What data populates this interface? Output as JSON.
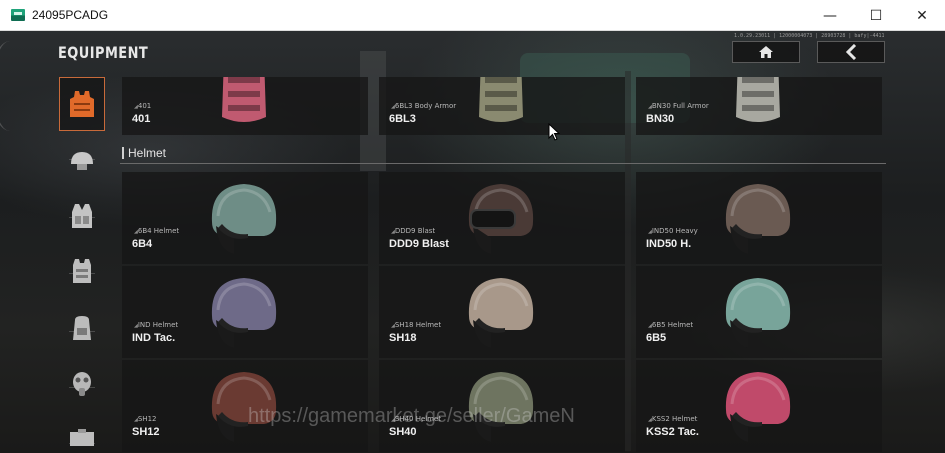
{
  "window": {
    "title": "24095PCADG",
    "minimize": "—",
    "maximize": "☐",
    "close": "✕"
  },
  "game": {
    "title": "EQUIPMENT",
    "info_text": "1.0.29.23011 | 12000004073 | 28903728 | bafy|-44110.118u",
    "watermark": "https://gamemarket.ge/seller/GameN"
  },
  "rail": [
    {
      "name": "vest",
      "icon": "vest-icon",
      "active": true
    },
    {
      "name": "helmet",
      "icon": "helmet-icon",
      "active": false
    },
    {
      "name": "rig",
      "icon": "rig-icon",
      "active": false
    },
    {
      "name": "plate-carrier",
      "icon": "plate-carrier-icon",
      "active": false
    },
    {
      "name": "backpack",
      "icon": "backpack-icon",
      "active": false
    },
    {
      "name": "gas-mask",
      "icon": "gas-mask-icon",
      "active": false
    },
    {
      "name": "case",
      "icon": "case-icon",
      "active": false
    }
  ],
  "armor_row": [
    {
      "sub": "401",
      "name": "401",
      "color": "#c05a70"
    },
    {
      "sub": "6BL3 Body Armor",
      "name": "6BL3",
      "color": "#8a8a70"
    },
    {
      "sub": "BN30 Full Armor",
      "name": "BN30",
      "color": "#a8a8a0"
    }
  ],
  "section": {
    "label": "Helmet"
  },
  "helmets": [
    {
      "sub": "6B4 Helmet",
      "name": "6B4",
      "color": "#6e8d86",
      "visor": false
    },
    {
      "sub": "DDD9 Blast",
      "name": "DDD9 Blast",
      "color": "#4a3a36",
      "visor": true
    },
    {
      "sub": "IND50 Heavy",
      "name": "IND50 H.",
      "color": "#6a5a52",
      "visor": false
    },
    {
      "sub": "IND Helmet",
      "name": "IND Tac.",
      "color": "#6e6a88",
      "visor": false
    },
    {
      "sub": "SH18 Helmet",
      "name": "SH18",
      "color": "#a8988a",
      "visor": false
    },
    {
      "sub": "6B5 Helmet",
      "name": "6B5",
      "color": "#78a49a",
      "visor": false
    },
    {
      "sub": "SH12",
      "name": "SH12",
      "color": "#6a3a32",
      "visor": false
    },
    {
      "sub": "SH40 Helmet",
      "name": "SH40",
      "color": "#6e7460",
      "visor": false
    },
    {
      "sub": "KSS2 Helmet",
      "name": "KSS2 Tac.",
      "color": "#c04a6a",
      "visor": false
    }
  ]
}
